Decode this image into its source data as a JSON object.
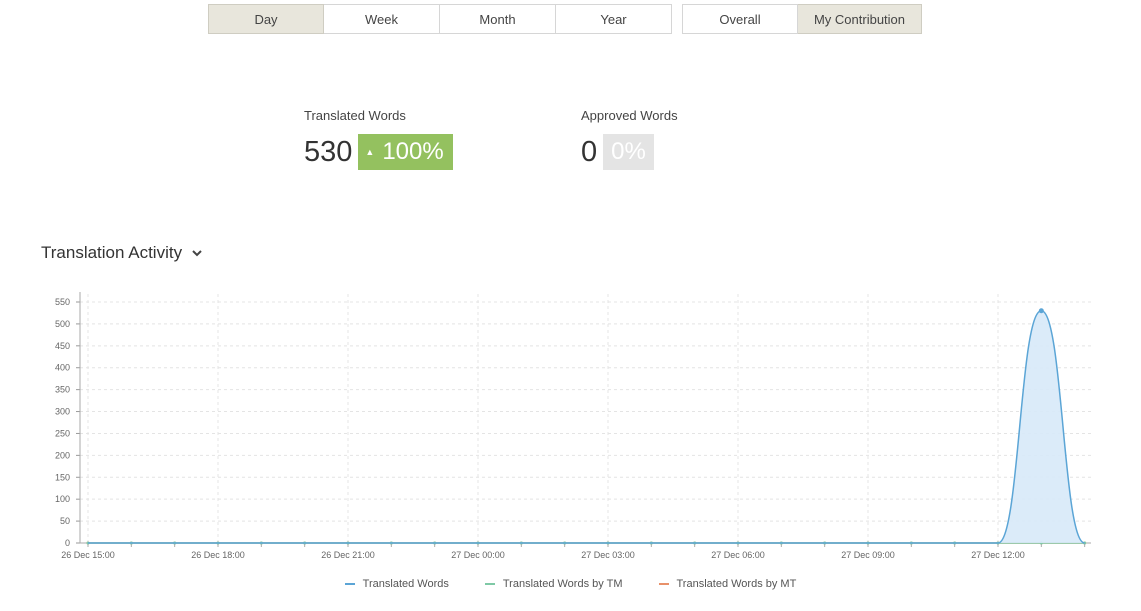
{
  "period_buttons": [
    {
      "label": "Day",
      "active": true
    },
    {
      "label": "Week",
      "active": false
    },
    {
      "label": "Month",
      "active": false
    },
    {
      "label": "Year",
      "active": false
    }
  ],
  "scope_buttons": [
    {
      "label": "Overall",
      "active": false
    },
    {
      "label": "My Contribution",
      "active": true
    }
  ],
  "stats": {
    "translated": {
      "label": "Translated Words",
      "value": "530",
      "change": "100%",
      "trend": "up"
    },
    "approved": {
      "label": "Approved Words",
      "value": "0",
      "change": "0%",
      "trend": "neutral"
    }
  },
  "section": {
    "title": "Translation Activity",
    "icon": "chevron-down-icon"
  },
  "chart_data": {
    "type": "area",
    "x_ticks": [
      "26 Dec 15:00",
      "26 Dec 18:00",
      "26 Dec 21:00",
      "27 Dec 00:00",
      "27 Dec 03:00",
      "27 Dec 06:00",
      "27 Dec 09:00",
      "27 Dec 12:00"
    ],
    "y_ticks": [
      0,
      50,
      100,
      150,
      200,
      250,
      300,
      350,
      400,
      450,
      500,
      550
    ],
    "ylim": [
      0,
      550
    ],
    "grid": true,
    "legend_position": "bottom",
    "series": [
      {
        "name": "Translated Words",
        "color": "#5ba5d6",
        "fill": "#d7e9f8",
        "x": [
          "26 Dec 15:00",
          "26 Dec 16:00",
          "26 Dec 17:00",
          "26 Dec 18:00",
          "26 Dec 19:00",
          "26 Dec 20:00",
          "26 Dec 21:00",
          "26 Dec 22:00",
          "26 Dec 23:00",
          "27 Dec 00:00",
          "27 Dec 01:00",
          "27 Dec 02:00",
          "27 Dec 03:00",
          "27 Dec 04:00",
          "27 Dec 05:00",
          "27 Dec 06:00",
          "27 Dec 07:00",
          "27 Dec 08:00",
          "27 Dec 09:00",
          "27 Dec 10:00",
          "27 Dec 11:00",
          "27 Dec 12:00",
          "27 Dec 13:00",
          "27 Dec 14:00"
        ],
        "values": [
          0,
          0,
          0,
          0,
          0,
          0,
          0,
          0,
          0,
          0,
          0,
          0,
          0,
          0,
          0,
          0,
          0,
          0,
          0,
          0,
          0,
          0,
          530,
          0
        ]
      },
      {
        "name": "Translated Words by TM",
        "color": "#7fc9a6",
        "values": [
          0,
          0,
          0,
          0,
          0,
          0,
          0,
          0,
          0,
          0,
          0,
          0,
          0,
          0,
          0,
          0,
          0,
          0,
          0,
          0,
          0,
          0,
          0,
          0
        ]
      },
      {
        "name": "Translated Words by MT",
        "color": "#e8916a",
        "values": [
          0,
          0,
          0,
          0,
          0,
          0,
          0,
          0,
          0,
          0,
          0,
          0,
          0,
          0,
          0,
          0,
          0,
          0,
          0,
          0,
          0,
          0,
          0,
          0
        ]
      }
    ]
  }
}
